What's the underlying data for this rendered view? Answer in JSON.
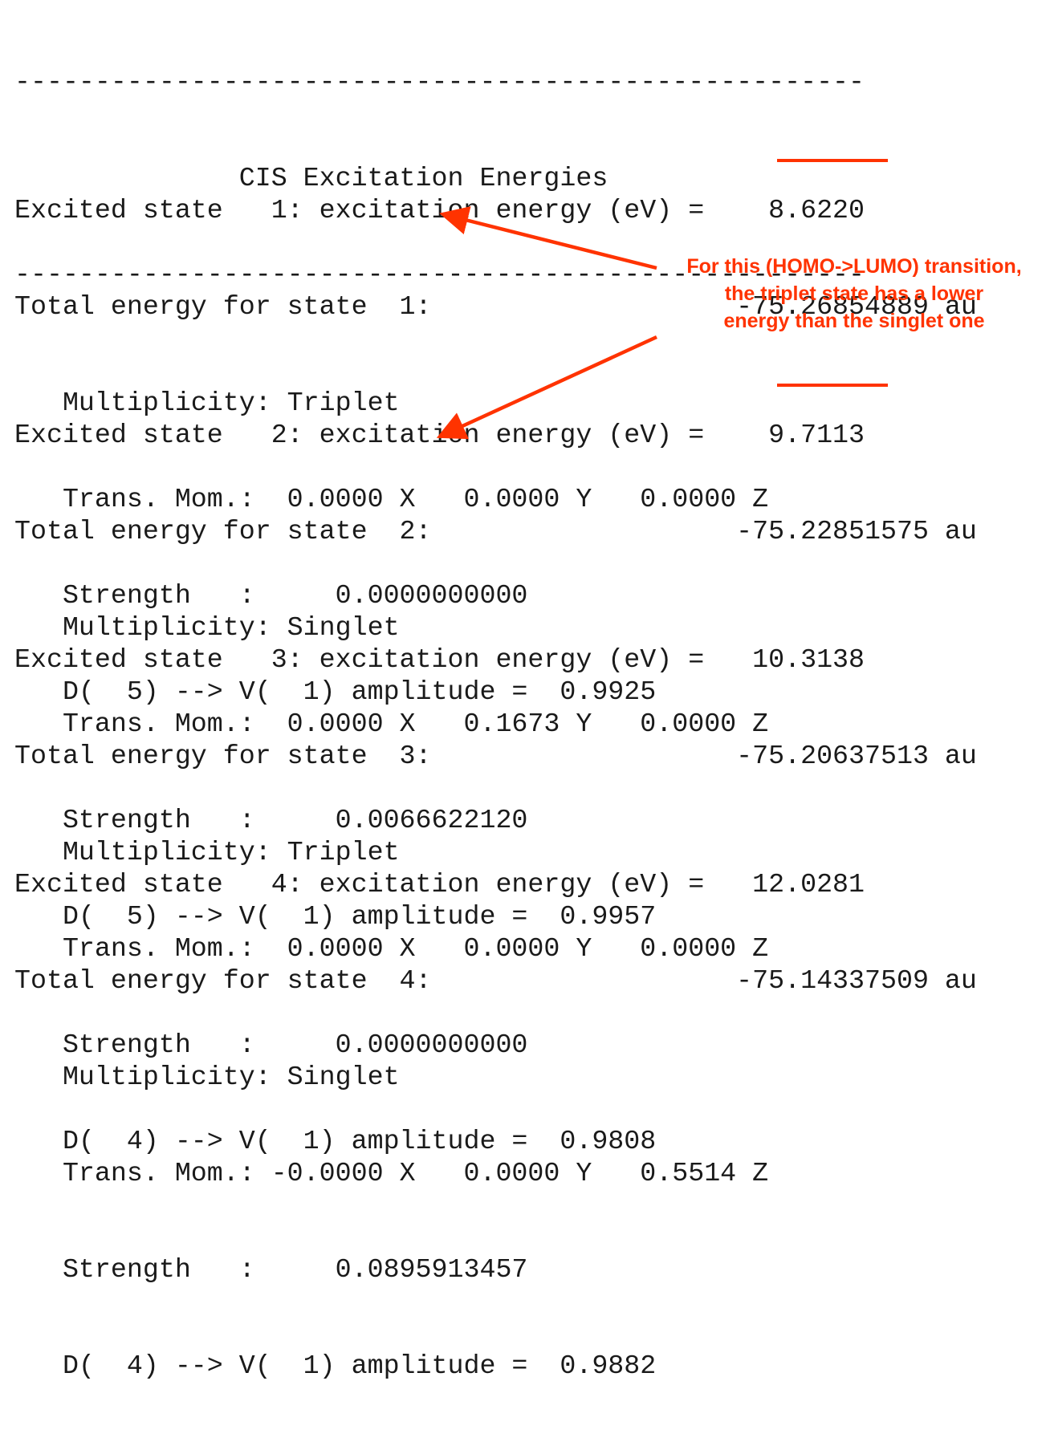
{
  "header": {
    "rule_top": "-----------------------------------------------------",
    "title": "              CIS Excitation Energies",
    "rule_bottom": "-----------------------------------------------------"
  },
  "states": [
    {
      "excited": "Excited state   1: excitation energy (eV) =    8.6220",
      "total": "Total energy for state  1:                   -75.26854889 au",
      "multiplicity": "   Multiplicity: Triplet",
      "trans": "   Trans. Mom.:  0.0000 X   0.0000 Y   0.0000 Z",
      "strength": "   Strength   :     0.0000000000",
      "amplitude": "   D(  5) --> V(  1) amplitude =  0.9925"
    },
    {
      "excited": "Excited state   2: excitation energy (eV) =    9.7113",
      "total": "Total energy for state  2:                   -75.22851575 au",
      "multiplicity": "   Multiplicity: Singlet",
      "trans": "   Trans. Mom.:  0.0000 X   0.1673 Y   0.0000 Z",
      "strength": "   Strength   :     0.0066622120",
      "amplitude": "   D(  5) --> V(  1) amplitude =  0.9957"
    },
    {
      "excited": "Excited state   3: excitation energy (eV) =   10.3138",
      "total": "Total energy for state  3:                   -75.20637513 au",
      "multiplicity": "   Multiplicity: Triplet",
      "trans": "   Trans. Mom.:  0.0000 X   0.0000 Y   0.0000 Z",
      "strength": "   Strength   :     0.0000000000",
      "amplitude": "   D(  4) --> V(  1) amplitude =  0.9808"
    },
    {
      "excited": "Excited state   4: excitation energy (eV) =   12.0281",
      "total": "Total energy for state  4:                   -75.14337509 au",
      "multiplicity": "   Multiplicity: Singlet",
      "trans": "   Trans. Mom.: -0.0000 X   0.0000 Y   0.5514 Z",
      "strength": "   Strength   :     0.0895913457",
      "amplitude": "   D(  4) --> V(  1) amplitude =  0.9882"
    }
  ],
  "annotation": {
    "line1": "For this (HOMO->LUMO) transition,",
    "line2": "the triplet state has a lower",
    "line3": "energy than the singlet one",
    "color": "#ff3300"
  }
}
